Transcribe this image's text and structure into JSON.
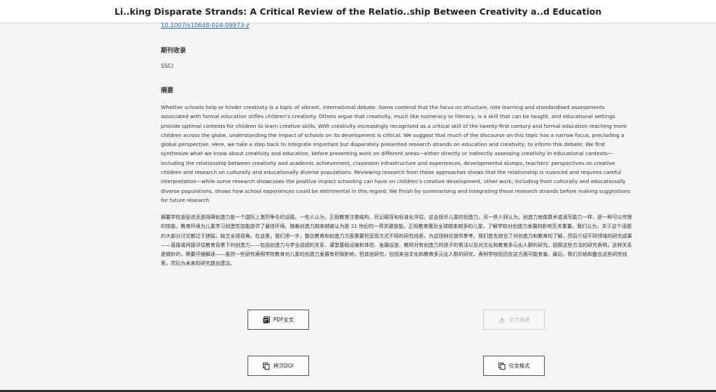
{
  "window": {
    "title": "Li..king Disparate Strands: A Critical Review of the Relatio..ship Between Creativity a..d Education"
  },
  "doi": {
    "link_text": "10.1007/s10648-024-09973-z"
  },
  "journal": {
    "heading": "期刊收录",
    "value": "SSCI"
  },
  "abstract": {
    "heading": "摘要",
    "english": "Whether schools help or hinder creativity is a topic of vibrant, international debate. Some contend that the focus on structure, rote learning and standardised assessments associated with formal education stifles children’s creativity. Others argue that creativity, much like numeracy or literacy, is a skill that can be taught, and educational settings provide optimal contexts for children to learn creative skills. With creativity increasingly recognised as a critical skill of the twenty-first century and formal education reaching more children across the globe, understanding the impact of schools on its development is critical. We suggest that much of the discourse on this topic has a narrow focus, precluding a global perspective. Here, we take a step back to integrate important but disparately presented research strands on education and creativity, to inform this debate. We first synthesize what we know about creativity and education, before presenting work on different areas—either directly or indirectly assessing creativity in educational contexts—including the relationship between creativity and academic achievement, classroom infrastructure and experiences, developmental slumps, teachers’ perspectives on creative children and research on culturally and educationally diverse populations. Reviewing research from these approaches shows that the relationship is nuanced and requires careful interpretation—while some research showcases the positive impact schooling can have on children’s creative development, other work, including from culturally and educationally diverse populations, shows how school experiences could be detrimental in this regard. We finish by summarising and integrating these research strands before making suggestions for future research",
    "chinese": "摘要学校是促进还是阻碍创造力是一个国际上激烈争论的话题。一些人认为，正规教育注重结构、死记硬背和标准化评估，这会扼杀儿童的创造力。另一些人则认为，创造力就像算术或读写能力一样，是一种可以传授的技能，教育环境为儿童学习创造性技能提供了最佳环境。随着创造力越来越被认为是 21 世纪的一项关键技能，正规教育惠及全球越来越多的儿童，了解学校对创造力发展的影响至关重要。我们认为，关于这个话题的大部分讨论都过于狭隘，缺乏全球视角。在这里，我们退一步，整合教育和创造力方面重要但呈现方式不同的研究线索，为这场辩论提供参考。我们首先综合了对创造力和教育的了解，然后介绍不同领域的研究成果——直接或间接评估教育背景下的创造力——包括创造力与学业成绩的关系、课堂基础设施和体验、发展低迷、教师对有创造力的孩子的看法以及对文化和教育多元化人群的研究。回顾这些方法的研究表明，这种关系是微妙的，需要仔细解读——虽然一些研究表明学校教育对儿童的创造力发展有积极影响，但其他研究，包括来自文化和教育多元化人群的研究，表明学校经历在这方面可能有害。最后，我们总结和整合这些研究线索，然后为未来的研究提出建议。"
  },
  "actions": {
    "pdf_label": "PDF全文",
    "fulltext_label": "全文速递",
    "copy_doi_label": "拷贝DOI",
    "cite_label": "引文格式"
  },
  "icons": {
    "pdf": "pdf-file-icon",
    "fulltext": "upload-icon",
    "copy_doi": "copy-icon",
    "cite": "copy-icon"
  },
  "colors": {
    "link": "#2a6fbf",
    "background": "#f5f5f5",
    "disabled": "#bdbdbd"
  }
}
